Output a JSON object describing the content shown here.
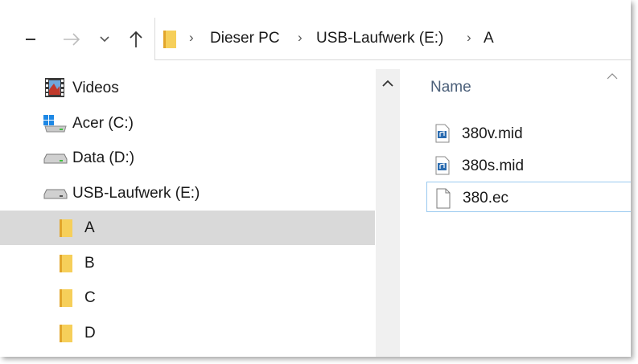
{
  "toolbar": {
    "icons": [
      "back-icon",
      "forward-icon",
      "recent-locations-icon",
      "up-arrow-icon"
    ]
  },
  "address_bar": {
    "breadcrumbs": [
      "Dieser PC",
      "USB-Laufwerk (E:)",
      "A"
    ]
  },
  "nav_pane": {
    "items": [
      {
        "label": "Videos",
        "icon": "videos-icon",
        "level": 0
      },
      {
        "label": "Acer (C:)",
        "icon": "windows-drive-icon",
        "level": 0
      },
      {
        "label": "Data (D:)",
        "icon": "drive-icon",
        "level": 0
      },
      {
        "label": "USB-Laufwerk (E:)",
        "icon": "usb-drive-icon",
        "level": 0
      },
      {
        "label": "A",
        "icon": "folder-icon",
        "level": 1,
        "selected": true
      },
      {
        "label": "B",
        "icon": "folder-icon",
        "level": 1
      },
      {
        "label": "C",
        "icon": "folder-icon",
        "level": 1
      },
      {
        "label": "D",
        "icon": "folder-icon",
        "level": 1
      }
    ]
  },
  "content": {
    "column_header": "Name",
    "files": [
      {
        "name": "380v.mid",
        "icon": "midi-file-icon"
      },
      {
        "name": "380s.mid",
        "icon": "midi-file-icon"
      },
      {
        "name": "380.ec",
        "icon": "blank-file-icon",
        "focused": true
      }
    ]
  },
  "colors": {
    "selection": "#d9d9d9",
    "focus_border": "#99c9ef",
    "header_text": "#4c607a",
    "folder": "#f2c94c"
  }
}
